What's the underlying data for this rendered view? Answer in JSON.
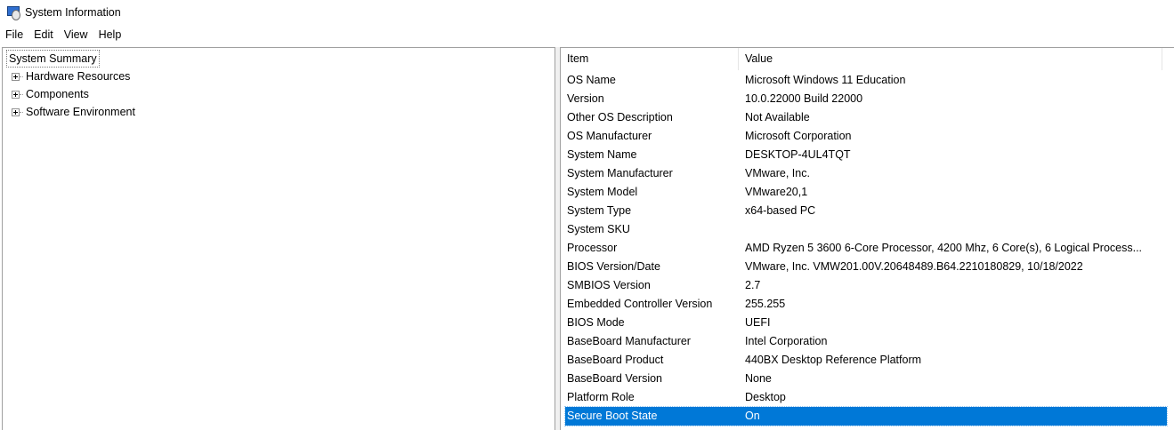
{
  "window": {
    "title": "System Information",
    "icon": "system-information-icon"
  },
  "menu": [
    "File",
    "Edit",
    "View",
    "Help"
  ],
  "tree": {
    "root": "System Summary",
    "children": [
      "Hardware Resources",
      "Components",
      "Software Environment"
    ]
  },
  "list": {
    "columns": [
      "Item",
      "Value"
    ],
    "rows": [
      {
        "item": "OS Name",
        "value": "Microsoft Windows 11 Education"
      },
      {
        "item": "Version",
        "value": "10.0.22000 Build 22000"
      },
      {
        "item": "Other OS Description",
        "value": "Not Available"
      },
      {
        "item": "OS Manufacturer",
        "value": "Microsoft Corporation"
      },
      {
        "item": "System Name",
        "value": "DESKTOP-4UL4TQT"
      },
      {
        "item": "System Manufacturer",
        "value": "VMware, Inc."
      },
      {
        "item": "System Model",
        "value": "VMware20,1"
      },
      {
        "item": "System Type",
        "value": "x64-based PC"
      },
      {
        "item": "System SKU",
        "value": ""
      },
      {
        "item": "Processor",
        "value": "AMD Ryzen 5 3600 6-Core Processor, 4200 Mhz, 6 Core(s), 6 Logical Process..."
      },
      {
        "item": "BIOS Version/Date",
        "value": "VMware, Inc. VMW201.00V.20648489.B64.2210180829, 10/18/2022"
      },
      {
        "item": "SMBIOS Version",
        "value": "2.7"
      },
      {
        "item": "Embedded Controller Version",
        "value": "255.255"
      },
      {
        "item": "BIOS Mode",
        "value": "UEFI"
      },
      {
        "item": "BaseBoard Manufacturer",
        "value": "Intel Corporation"
      },
      {
        "item": "BaseBoard Product",
        "value": "440BX Desktop Reference Platform"
      },
      {
        "item": "BaseBoard Version",
        "value": "None"
      },
      {
        "item": "Platform Role",
        "value": "Desktop"
      },
      {
        "item": "Secure Boot State",
        "value": "On"
      }
    ],
    "selected_index": 18
  },
  "colors": {
    "selection": "#0078d7",
    "border": "#a0a0a0"
  }
}
